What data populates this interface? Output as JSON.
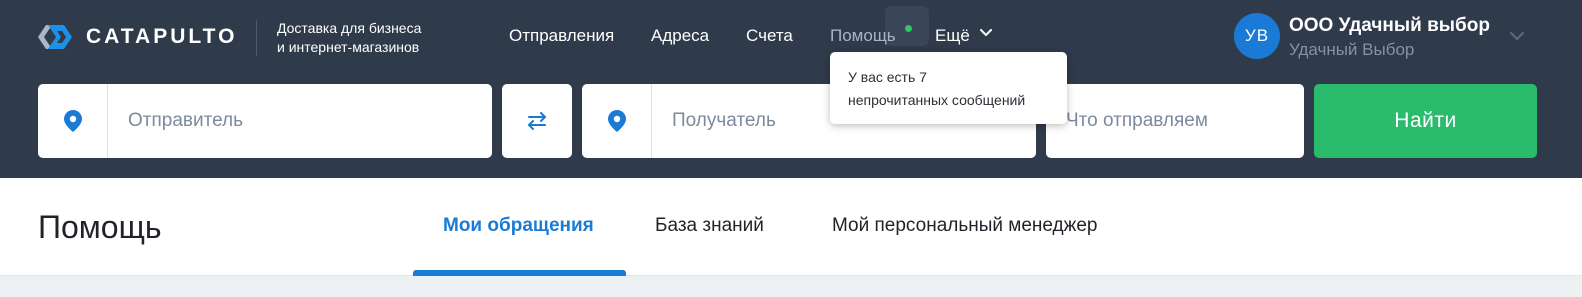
{
  "brand": {
    "name": "CATAPULTO",
    "tagline_line1": "Доставка для бизнеса",
    "tagline_line2": "и интернет-магазинов"
  },
  "nav": {
    "items": [
      {
        "label": "Отправления"
      },
      {
        "label": "Адреса"
      },
      {
        "label": "Счета"
      },
      {
        "label": "Помощь"
      },
      {
        "label": "Ещё"
      }
    ]
  },
  "tooltip": {
    "line1": "У вас есть 7",
    "line2": "непрочитанных сообщений"
  },
  "account": {
    "initials": "УВ",
    "name": "ООО Удачный выбор",
    "subtitle": "Удачный Выбор"
  },
  "search": {
    "sender_placeholder": "Отправитель",
    "recipient_placeholder": "Получатель",
    "cargo_placeholder": "Что отправляем",
    "find_label": "Найти"
  },
  "page": {
    "title": "Помощь",
    "tabs": [
      {
        "label": "Мои обращения",
        "active": true
      },
      {
        "label": "База знаний",
        "active": false
      },
      {
        "label": "Мой персональный менеджер",
        "active": false
      }
    ]
  },
  "colors": {
    "header_bg": "#2f3a4b",
    "accent_blue": "#1a7bd6",
    "accent_green": "#2bbb6d",
    "notification_dot": "#32c46b"
  },
  "icons": {
    "logo": "catapulto-logo-icon",
    "location": "location-pin-icon",
    "swap": "swap-arrows-icon",
    "chevron": "chevron-down-icon"
  }
}
